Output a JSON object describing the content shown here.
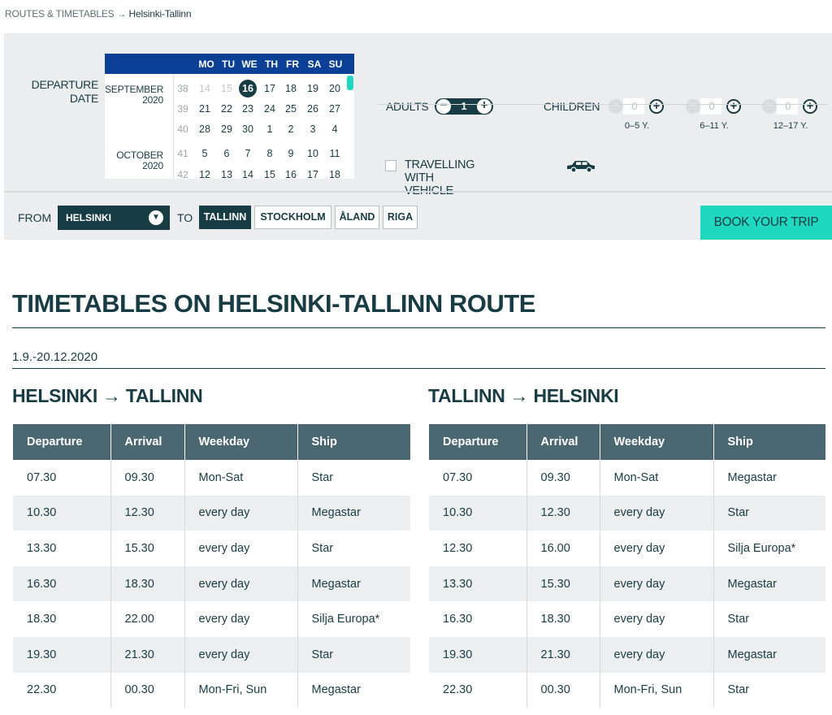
{
  "breadcrumb": {
    "parent": "ROUTES & TIMETABLES",
    "separator": "→",
    "current": "Helsinki-Tallinn"
  },
  "booking": {
    "departure_label_1": "DEPARTURE",
    "departure_label_2": "DATE",
    "calendar": {
      "weekdays": [
        "MO",
        "TU",
        "WE",
        "TH",
        "FR",
        "SA",
        "SU"
      ],
      "months": [
        {
          "name": "SEPTEMBER",
          "year": "2020"
        },
        {
          "name": "OCTOBER",
          "year": "2020"
        }
      ],
      "weeks": [
        {
          "week": "38",
          "days": [
            "14",
            "15",
            "16",
            "17",
            "18",
            "19",
            "20"
          ]
        },
        {
          "week": "39",
          "days": [
            "21",
            "22",
            "23",
            "24",
            "25",
            "26",
            "27"
          ]
        },
        {
          "week": "40",
          "days": [
            "28",
            "29",
            "30",
            "1",
            "2",
            "3",
            "4"
          ]
        },
        {
          "week": "41",
          "days": [
            "5",
            "6",
            "7",
            "8",
            "9",
            "10",
            "11"
          ]
        },
        {
          "week": "42",
          "days": [
            "12",
            "13",
            "14",
            "15",
            "16",
            "17",
            "18"
          ]
        }
      ],
      "selected_day": "16"
    },
    "adults": {
      "label": "ADULTS",
      "value": "1",
      "minus": "−",
      "plus": "+"
    },
    "children": {
      "label": "CHILDREN",
      "groups": [
        {
          "age": "0–5 Y.",
          "value": "0"
        },
        {
          "age": "6–11 Y.",
          "value": "0"
        },
        {
          "age": "12–17 Y.",
          "value": "0"
        }
      ]
    },
    "vehicle_label": "TRAVELLING WITH VEHICLE",
    "from_label": "FROM",
    "from_value": "HELSINKI",
    "to_label": "TO",
    "destinations": [
      "TALLINN",
      "STOCKHOLM",
      "ÅLAND",
      "RIGA"
    ],
    "book_button": "BOOK YOUR TRIP"
  },
  "page_title": "TIMETABLES ON HELSINKI-TALLINN ROUTE",
  "period": "1.9.-20.12.2020",
  "timetables": [
    {
      "title": "HELSINKI → TALLINN",
      "headers": [
        "Departure",
        "Arrival",
        "Weekday",
        "Ship"
      ],
      "rows": [
        [
          "07.30",
          "09.30",
          "Mon-Sat",
          "Star"
        ],
        [
          "10.30",
          "12.30",
          "every day",
          "Megastar"
        ],
        [
          "13.30",
          "15.30",
          "every day",
          "Star"
        ],
        [
          "16.30",
          "18.30",
          "every day",
          "Megastar"
        ],
        [
          "18.30",
          "22.00",
          "every day",
          "Silja Europa*"
        ],
        [
          "19.30",
          "21.30",
          "every day",
          "Star"
        ],
        [
          "22.30",
          "00.30",
          "Mon-Fri, Sun",
          "Megastar"
        ]
      ]
    },
    {
      "title": "TALLINN → HELSINKI",
      "headers": [
        "Departure",
        "Arrival",
        "Weekday",
        "Ship"
      ],
      "rows": [
        [
          "07.30",
          "09.30",
          "Mon-Sat",
          "Megastar"
        ],
        [
          "10.30",
          "12.30",
          "every day",
          "Star"
        ],
        [
          "12.30",
          "16.00",
          "every day",
          "Silja Europa*"
        ],
        [
          "13.30",
          "15.30",
          "every day",
          "Megastar"
        ],
        [
          "16.30",
          "18.30",
          "every day",
          "Star"
        ],
        [
          "19.30",
          "21.30",
          "every day",
          "Megastar"
        ],
        [
          "22.30",
          "00.30",
          "Mon-Fri, Sun",
          "Star"
        ]
      ]
    }
  ]
}
